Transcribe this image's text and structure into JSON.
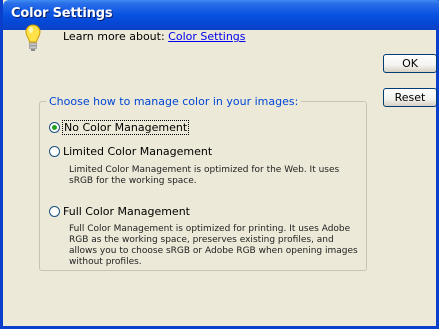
{
  "window": {
    "title": "Color Settings"
  },
  "learn": {
    "prefix": "Learn more about: ",
    "link": "Color Settings"
  },
  "buttons": {
    "ok": "OK",
    "reset": "Reset"
  },
  "group": {
    "label": "Choose how to manage color in your images:",
    "options": [
      {
        "label": "No Color Management",
        "selected": true,
        "description": ""
      },
      {
        "label": "Limited Color Management",
        "selected": false,
        "description": "Limited Color Management is optimized for the Web. It uses sRGB for the working space."
      },
      {
        "label": "Full Color Management",
        "selected": false,
        "description": "Full Color Management is optimized for printing. It uses Adobe RGB as the working space, preserves existing profiles, and allows you to choose sRGB or Adobe RGB when opening images without profiles."
      }
    ]
  },
  "colors": {
    "titlebar": "#0b55e3",
    "link": "#0000ee",
    "group_label": "#0046d5",
    "radio_dot": "#21a121"
  },
  "icons": {
    "hint": "lightbulb-icon"
  }
}
